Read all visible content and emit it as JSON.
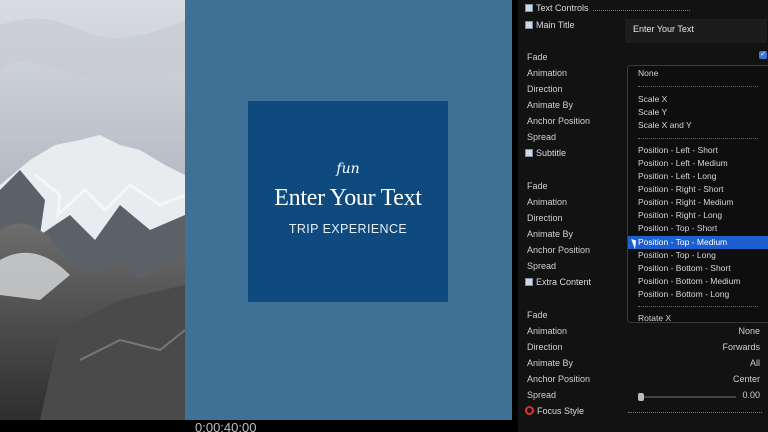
{
  "viewer": {
    "card_script": "fun",
    "card_title": "Enter Your Text",
    "card_subtitle": "TRIP EXPERIENCE",
    "canvas_color": "#3f7196",
    "card_color": "#0f4a7f"
  },
  "timecode": "0:00:40:00",
  "inspector": {
    "text_controls": "Text Controls",
    "main_title": {
      "label": "Main Title",
      "value": "Enter Your Text"
    },
    "group1": {
      "fade": "Fade",
      "animation": "Animation",
      "direction": "Direction",
      "animate_by": "Animate By",
      "anchor_position": "Anchor Position",
      "spread": "Spread"
    },
    "subtitle": "Subtitle",
    "group2": {
      "fade": "Fade",
      "animation": "Animation",
      "direction": "Direction",
      "animate_by": "Animate By",
      "anchor_position": "Anchor Position",
      "spread": "Spread"
    },
    "extra_content": "Extra Content",
    "group3": {
      "fade": "Fade",
      "animation": {
        "label": "Animation",
        "value": "None"
      },
      "direction": {
        "label": "Direction",
        "value": "Forwards"
      },
      "animate_by": {
        "label": "Animate By",
        "value": "All"
      },
      "anchor_position": {
        "label": "Anchor Position",
        "value": "Center"
      },
      "spread": {
        "label": "Spread",
        "value": "0.00"
      }
    },
    "focus_style": "Focus Style",
    "accent_color": "#1d5fd1"
  },
  "animation_menu": {
    "options": [
      "None",
      "Scale X",
      "Scale Y",
      "Scale X and Y",
      "Position - Left - Short",
      "Position - Left - Medium",
      "Position - Left - Long",
      "Position - Right - Short",
      "Position - Right - Medium",
      "Position - Right - Long",
      "Position - Top - Short",
      "Position - Top - Medium",
      "Position - Top - Long",
      "Position - Bottom - Short",
      "Position - Bottom - Medium",
      "Position - Bottom - Long",
      "Rotate X"
    ],
    "selected": "Position - Top - Medium"
  }
}
